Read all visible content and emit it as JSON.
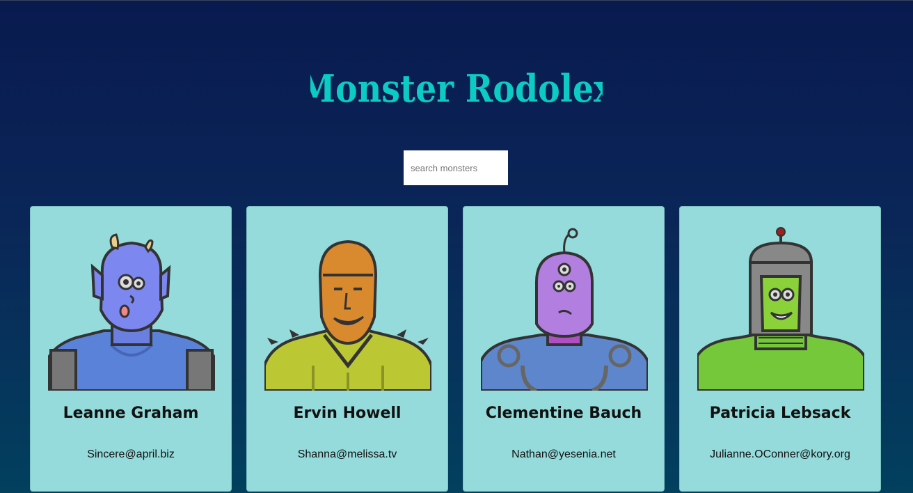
{
  "title": "Monster Rodolex",
  "search": {
    "placeholder": "search monsters"
  },
  "colors": {
    "title": "#0ccac4",
    "card_bg": "#95dbdb"
  },
  "monsters": [
    {
      "name": "Leanne Graham",
      "email": "Sincere@april.biz",
      "avatar": "blue-horned-monster-icon"
    },
    {
      "name": "Ervin Howell",
      "email": "Shanna@melissa.tv",
      "avatar": "orange-spiky-monster-icon"
    },
    {
      "name": "Clementine Bauch",
      "email": "Nathan@yesenia.net",
      "avatar": "purple-alien-robot-icon"
    },
    {
      "name": "Patricia Lebsack",
      "email": "Julianne.OConner@kory.org",
      "avatar": "green-helmet-monster-icon"
    }
  ]
}
